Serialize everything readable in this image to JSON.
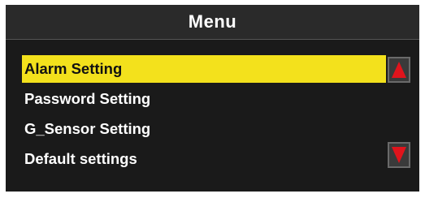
{
  "header": {
    "title": "Menu"
  },
  "menu": {
    "items": [
      {
        "label": "Alarm Setting",
        "selected": true
      },
      {
        "label": "Password Setting",
        "selected": false
      },
      {
        "label": "G_Sensor Setting",
        "selected": false
      },
      {
        "label": "Default settings",
        "selected": false
      }
    ]
  },
  "controls": {
    "scroll_up_icon": "triangle-up-icon",
    "scroll_down_icon": "triangle-down-icon"
  },
  "colors": {
    "selection": "#f3e11c",
    "arrow": "#e0141c",
    "background": "#1a1a1a",
    "text": "#ffffff"
  }
}
